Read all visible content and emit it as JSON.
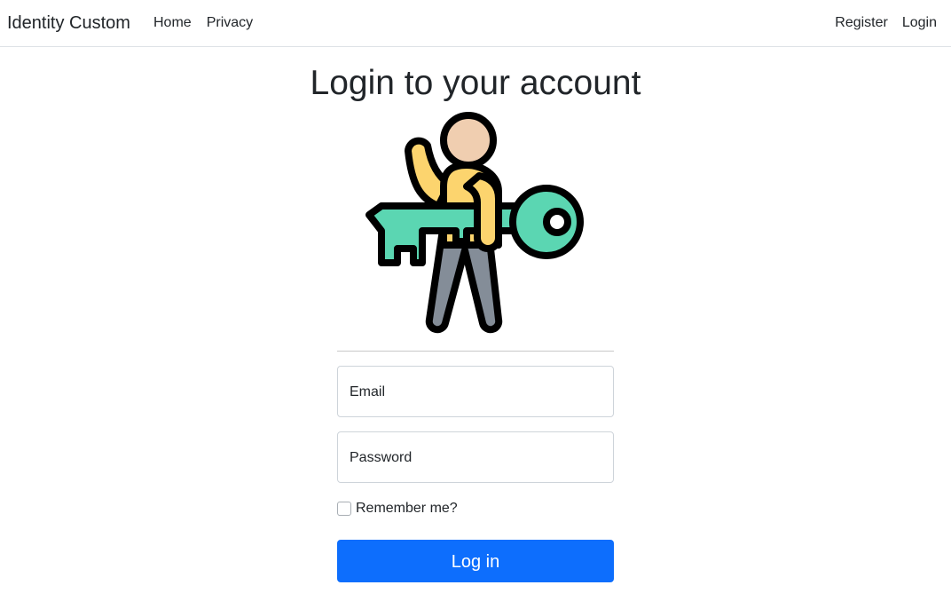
{
  "navbar": {
    "brand": "Identity Custom",
    "left_links": [
      "Home",
      "Privacy"
    ],
    "right_links": [
      "Register",
      "Login"
    ]
  },
  "main": {
    "title": "Login to your account",
    "illustration": "person-holding-key-icon",
    "email_label": "Email",
    "password_label": "Password",
    "remember_label": "Remember me?",
    "remember_checked": false,
    "login_button": "Log in"
  },
  "colors": {
    "primary": "#0d6efd",
    "key": "#5bd6b2",
    "shirt": "#fcd46e",
    "skin": "#f0ceb0",
    "pants": "#848d98",
    "outline": "#000000"
  }
}
